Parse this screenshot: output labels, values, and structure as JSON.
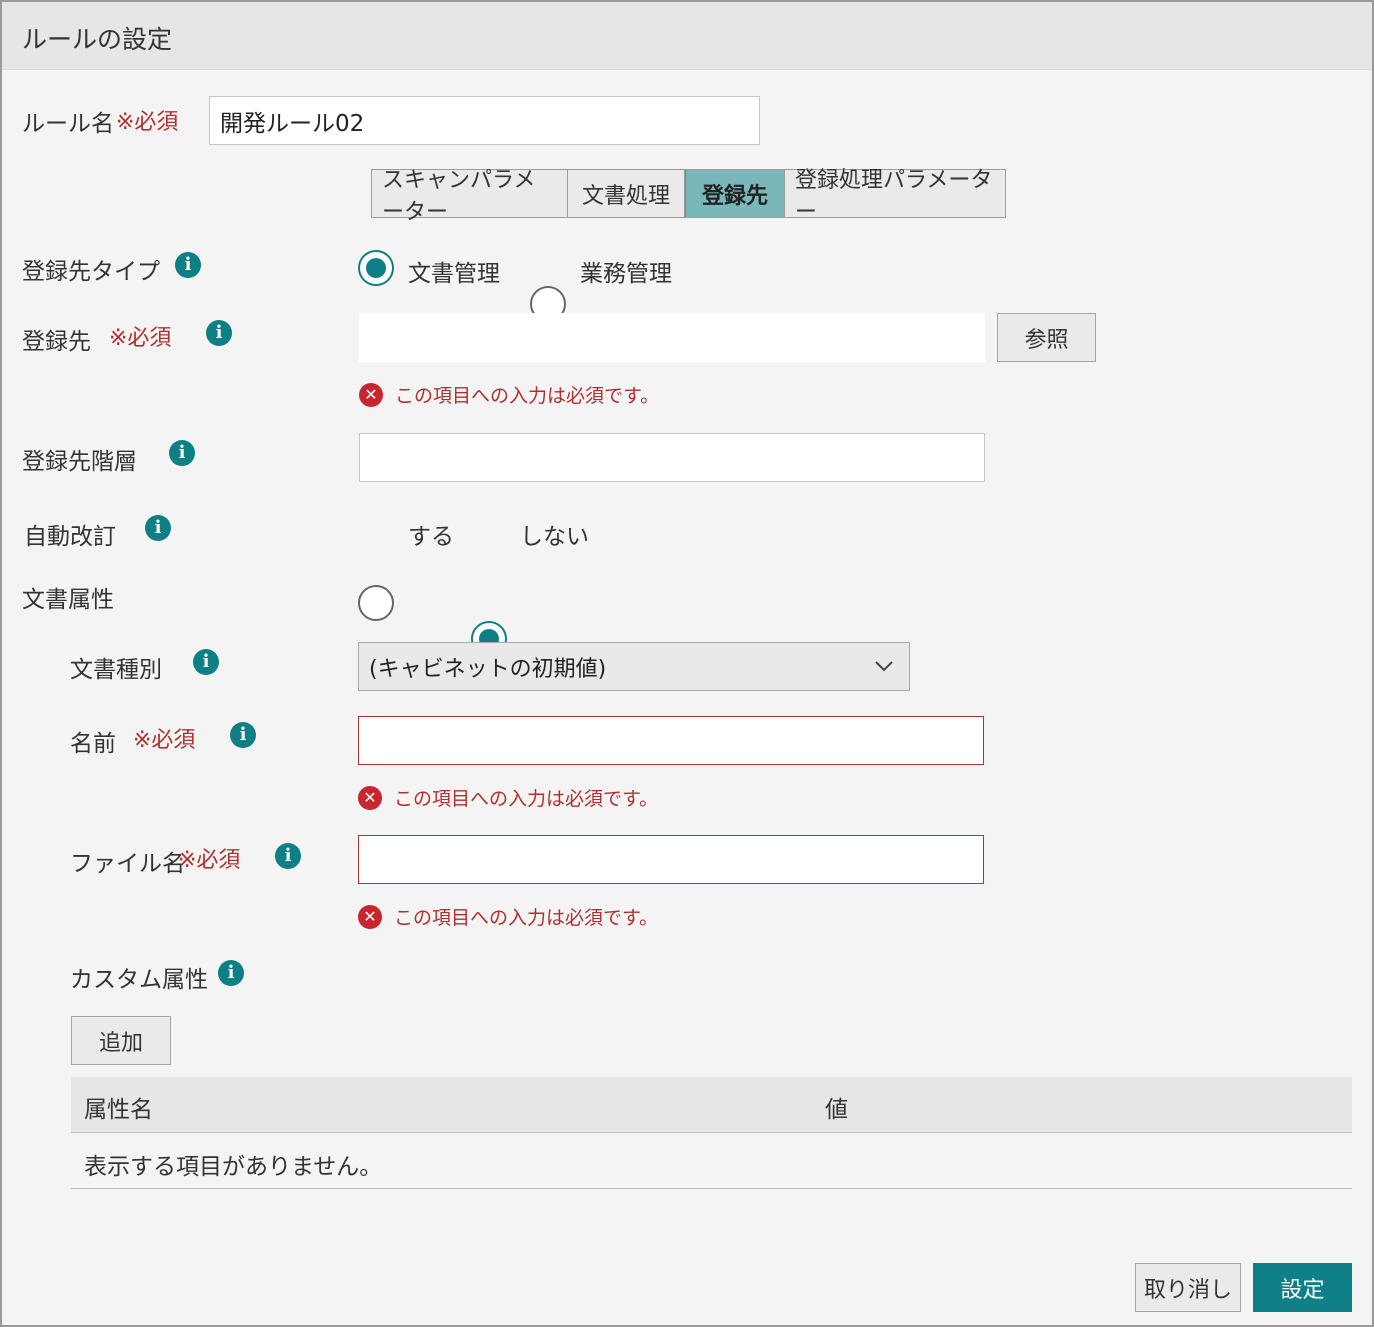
{
  "dialog": {
    "title": "ルールの設定"
  },
  "rule_name": {
    "label": "ルール名",
    "required": "※必須",
    "value": "開発ルール02"
  },
  "tabs": [
    {
      "label": "スキャンパラメーター",
      "active": false
    },
    {
      "label": "文書処理",
      "active": false
    },
    {
      "label": "登録先",
      "active": true
    },
    {
      "label": "登録処理パラメーター",
      "active": false
    }
  ],
  "dest_type": {
    "label": "登録先タイプ",
    "options": [
      {
        "label": "文書管理",
        "checked": true
      },
      {
        "label": "業務管理",
        "checked": false
      }
    ]
  },
  "destination": {
    "label": "登録先",
    "required": "※必須",
    "value": "",
    "browse_label": "参照",
    "error": "この項目への入力は必須です。"
  },
  "dest_hierarchy": {
    "label": "登録先階層",
    "value": ""
  },
  "auto_revision": {
    "label": "自動改訂",
    "options": [
      {
        "label": "する",
        "checked": false
      },
      {
        "label": "しない",
        "checked": true
      }
    ]
  },
  "doc_attrs": {
    "label": "文書属性",
    "doc_type": {
      "label": "文書種別",
      "selected": "(キャビネットの初期値)"
    },
    "name": {
      "label": "名前",
      "required": "※必須",
      "value": "",
      "error": "この項目への入力は必須です。"
    },
    "file_name": {
      "label": "ファイル名",
      "required": "※必須",
      "value": "",
      "error": "この項目への入力は必須です。"
    },
    "custom": {
      "label": "カスタム属性",
      "add_label": "追加",
      "columns": [
        "属性名",
        "値"
      ],
      "empty_message": "表示する項目がありません。"
    }
  },
  "footer": {
    "cancel_label": "取り消し",
    "ok_label": "設定"
  },
  "icons": {
    "info": "info-icon",
    "error": "error-icon",
    "dropdown": "chevron-down-icon"
  },
  "colors": {
    "accent": "#0f8087",
    "error": "#b03030",
    "tab_active": "#79b7bb"
  }
}
